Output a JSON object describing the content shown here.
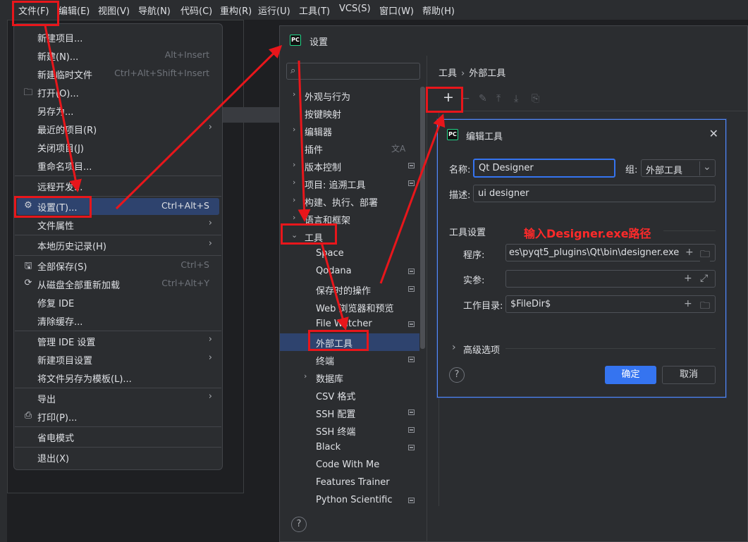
{
  "menubar": {
    "items": [
      "文件(F)",
      "编辑(E)",
      "视图(V)",
      "导航(N)",
      "代码(C)",
      "重构(R)",
      "运行(U)",
      "工具(T)",
      "VCS(S)",
      "窗口(W)",
      "帮助(H)"
    ]
  },
  "file_menu": {
    "items": [
      {
        "label": "新建项目...",
        "shortcut": ""
      },
      {
        "label": "新建(N)...",
        "shortcut": "Alt+Insert"
      },
      {
        "label": "新建临时文件",
        "shortcut": "Ctrl+Alt+Shift+Insert"
      },
      {
        "label": "打开(O)...",
        "shortcut": "",
        "icon": "folder-icon"
      },
      {
        "label": "另存为...",
        "shortcut": ""
      },
      {
        "label": "最近的项目(R)",
        "shortcut": "",
        "submenu": true
      },
      {
        "label": "关闭项目(J)",
        "shortcut": ""
      },
      {
        "label": "重命名项目...",
        "shortcut": ""
      },
      {
        "label": "远程开发...",
        "shortcut": ""
      },
      {
        "label": "设置(T)...",
        "shortcut": "Ctrl+Alt+S",
        "icon": "gear-icon",
        "selected": true
      },
      {
        "label": "文件属性",
        "shortcut": "",
        "submenu": true
      },
      {
        "label": "本地历史记录(H)",
        "shortcut": "",
        "submenu": true
      },
      {
        "label": "全部保存(S)",
        "shortcut": "Ctrl+S",
        "icon": "save-icon"
      },
      {
        "label": "从磁盘全部重新加载",
        "shortcut": "Ctrl+Alt+Y",
        "icon": "reload-icon"
      },
      {
        "label": "修复 IDE",
        "shortcut": ""
      },
      {
        "label": "清除缓存...",
        "shortcut": ""
      },
      {
        "label": "管理 IDE 设置",
        "shortcut": "",
        "submenu": true
      },
      {
        "label": "新建项目设置",
        "shortcut": "",
        "submenu": true
      },
      {
        "label": "将文件另存为模板(L)...",
        "shortcut": ""
      },
      {
        "label": "导出",
        "shortcut": "",
        "submenu": true
      },
      {
        "label": "打印(P)...",
        "shortcut": "",
        "icon": "print-icon"
      },
      {
        "label": "省电模式",
        "shortcut": ""
      },
      {
        "label": "退出(X)",
        "shortcut": ""
      }
    ]
  },
  "settings": {
    "title": "设置",
    "logo": "PC",
    "search_placeholder": "",
    "breadcrumb": [
      "工具",
      "外部工具"
    ],
    "tree": [
      {
        "label": "外观与行为",
        "level": 0,
        "expandable": true
      },
      {
        "label": "按键映射",
        "level": 0
      },
      {
        "label": "编辑器",
        "level": 0,
        "expandable": true
      },
      {
        "label": "插件",
        "level": 0,
        "translate_icon": true
      },
      {
        "label": "版本控制",
        "level": 0,
        "expandable": true,
        "marker": true
      },
      {
        "label": "项目: 追溯工具",
        "level": 0,
        "expandable": true,
        "marker": true
      },
      {
        "label": "构建、执行、部署",
        "level": 0,
        "expandable": true
      },
      {
        "label": "语言和框架",
        "level": 0,
        "expandable": true
      },
      {
        "label": "工具",
        "level": 0,
        "expanded": true
      },
      {
        "label": "Space",
        "level": 1
      },
      {
        "label": "Qodana",
        "level": 1,
        "marker": true
      },
      {
        "label": "保存时的操作",
        "level": 1,
        "marker": true
      },
      {
        "label": "Web 浏览器和预览",
        "level": 1
      },
      {
        "label": "File Watcher",
        "level": 1,
        "marker": true
      },
      {
        "label": "外部工具",
        "level": 1,
        "selected": true
      },
      {
        "label": "终端",
        "level": 1,
        "marker": true
      },
      {
        "label": "数据库",
        "level": 1,
        "expandable": true
      },
      {
        "label": "CSV 格式",
        "level": 1
      },
      {
        "label": "SSH 配置",
        "level": 1,
        "marker": true
      },
      {
        "label": "SSH 终端",
        "level": 1,
        "marker": true
      },
      {
        "label": "Black",
        "level": 1,
        "marker": true
      },
      {
        "label": "Code With Me",
        "level": 1
      },
      {
        "label": "Features Trainer",
        "level": 1
      },
      {
        "label": "Python Scientific",
        "level": 1,
        "marker": true
      }
    ]
  },
  "dialog": {
    "title": "编辑工具",
    "name_label": "名称:",
    "name_value": "Qt Designer",
    "group_label": "组:",
    "group_value": "外部工具",
    "desc_label": "描述:",
    "desc_value": "ui designer",
    "tool_settings_label": "工具设置",
    "program_label": "程序:",
    "program_value": "es\\pyqt5_plugins\\Qt\\bin\\designer.exe",
    "args_label": "实参:",
    "args_value": "",
    "workdir_label": "工作目录:",
    "workdir_value": "$FileDir$",
    "advanced_label": "高级选项",
    "ok_label": "确定",
    "cancel_label": "取消"
  },
  "annotation": {
    "text": "输入Designer.exe路径",
    "color": "#ff2a2a"
  },
  "colors": {
    "accent": "#3574f0",
    "selection": "#2e436e",
    "highlight_red": "#e8161b"
  }
}
